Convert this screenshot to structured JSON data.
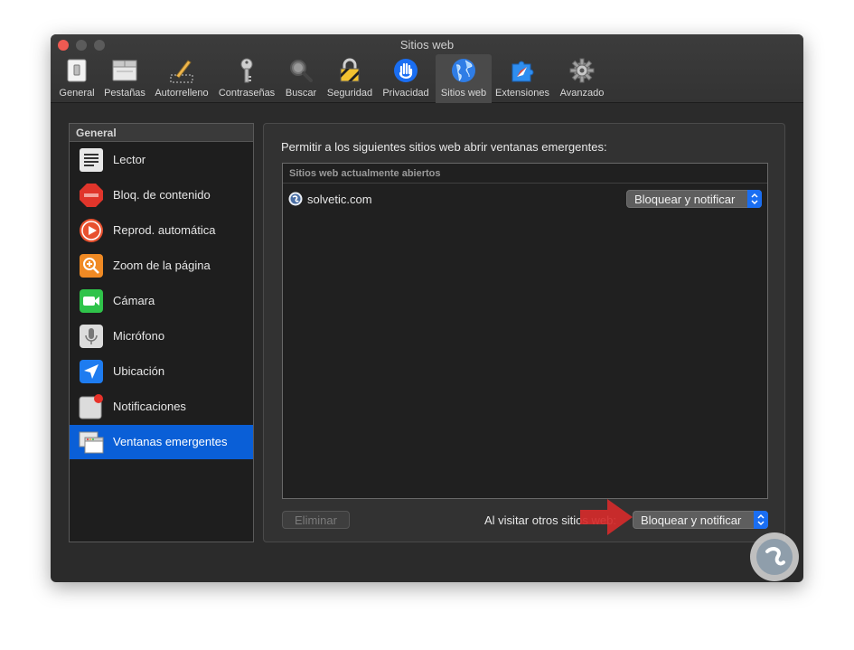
{
  "window": {
    "title": "Sitios web"
  },
  "toolbar": {
    "items": [
      {
        "label": "General",
        "icon": "switch-icon"
      },
      {
        "label": "Pestañas",
        "icon": "tabs-icon"
      },
      {
        "label": "Autorrelleno",
        "icon": "pencil-icon"
      },
      {
        "label": "Contraseñas",
        "icon": "key-icon"
      },
      {
        "label": "Buscar",
        "icon": "magnifier-icon"
      },
      {
        "label": "Seguridad",
        "icon": "lock-icon"
      },
      {
        "label": "Privacidad",
        "icon": "hand-icon"
      },
      {
        "label": "Sitios web",
        "icon": "globe-icon"
      },
      {
        "label": "Extensiones",
        "icon": "puzzle-icon"
      },
      {
        "label": "Avanzado",
        "icon": "gear-icon"
      }
    ],
    "active": "Sitios web"
  },
  "sidebar": {
    "header": "General",
    "items": [
      {
        "label": "Lector",
        "icon": "reader-icon"
      },
      {
        "label": "Bloq. de contenido",
        "icon": "stop-icon"
      },
      {
        "label": "Reprod. automática",
        "icon": "play-icon"
      },
      {
        "label": "Zoom de la página",
        "icon": "zoom-icon"
      },
      {
        "label": "Cámara",
        "icon": "camera-icon"
      },
      {
        "label": "Micrófono",
        "icon": "microphone-icon"
      },
      {
        "label": "Ubicación",
        "icon": "location-icon"
      },
      {
        "label": "Notificaciones",
        "icon": "notification-icon"
      },
      {
        "label": "Ventanas emergentes",
        "icon": "popup-windows-icon"
      }
    ],
    "selected": "Ventanas emergentes"
  },
  "panel": {
    "heading": "Permitir a los siguientes sitios web abrir ventanas emergentes:",
    "list_header": "Sitios web actualmente abiertos",
    "sites": [
      {
        "name": "solvetic.com",
        "setting": "Bloquear y notificar"
      }
    ],
    "remove_label": "Eliminar",
    "other_sites_label": "Al visitar otros sitios web:",
    "other_sites_setting": "Bloquear y notificar"
  },
  "colors": {
    "selection": "#0a5fd7",
    "popup_arrow": "#1a6ef2",
    "close_button": "#ee5a52",
    "annotation_arrow": "#d42a2a"
  }
}
